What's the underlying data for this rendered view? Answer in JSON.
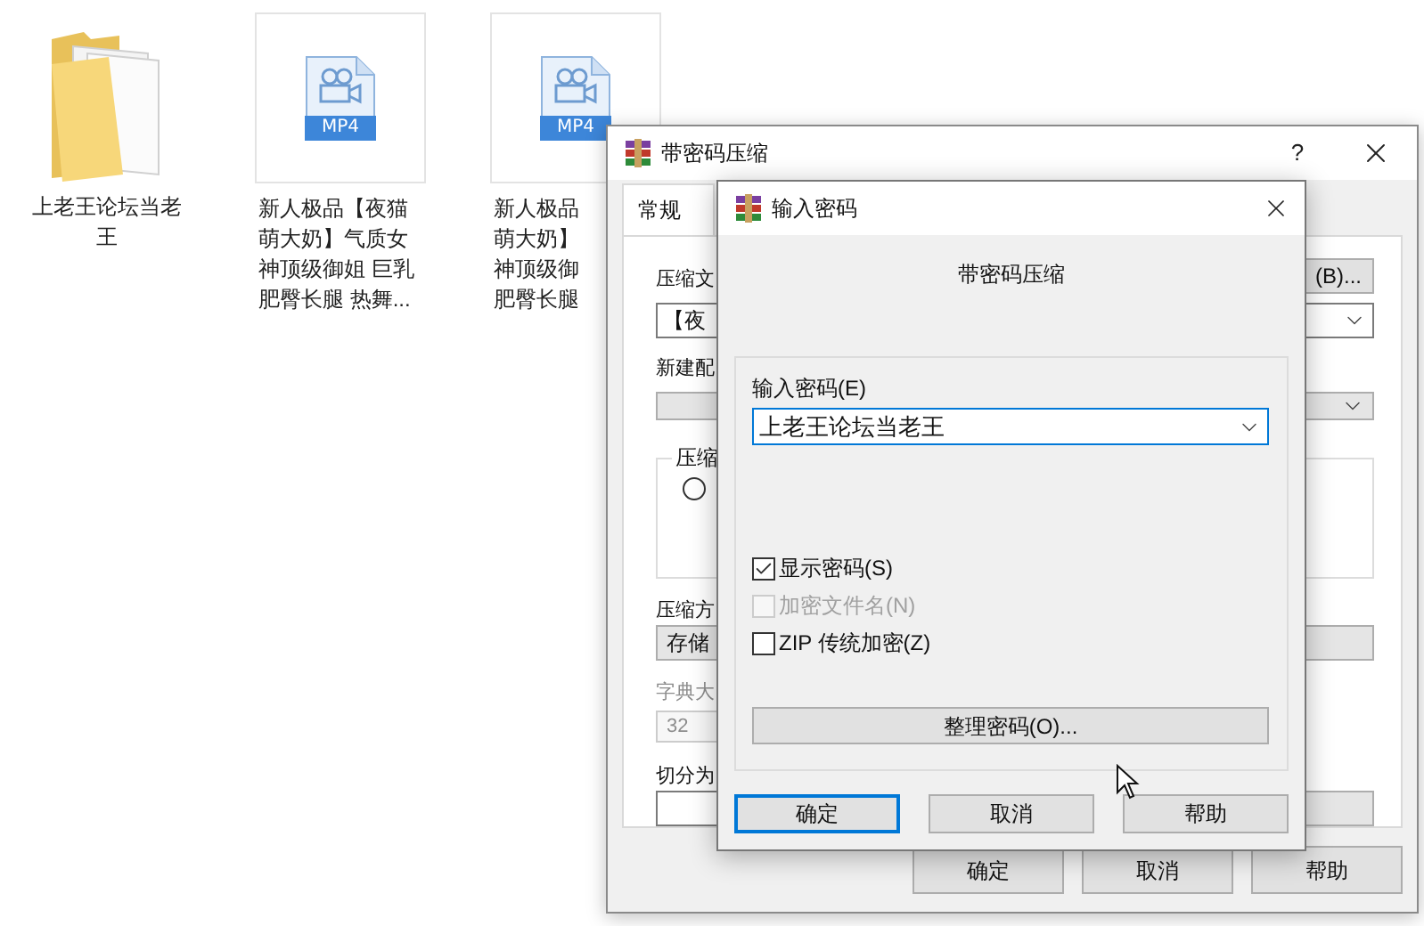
{
  "desktop_items": [
    {
      "kind": "folder",
      "label": "上老王论坛当老王"
    },
    {
      "kind": "video",
      "badge": "MP4",
      "label": "新人极品【夜猫萌大奶】气质女神顶级御姐 巨乳肥臀长腿 热舞..."
    },
    {
      "kind": "video",
      "badge": "MP4",
      "label_lines": [
        "新人极品",
        "萌大奶】",
        "神顶级御",
        "肥臀长腿"
      ]
    }
  ],
  "archive_dialog": {
    "title": "带密码压缩",
    "help": "?",
    "tabs": [
      {
        "label": "常规",
        "selected": true
      }
    ],
    "archive_name_label": "压缩文",
    "browse_button": "(B)...",
    "archive_name_value": "【夜",
    "profile_label": "新建配",
    "group_label": "压缩",
    "format_radio": {
      "selected": false
    },
    "method_label": "压缩方",
    "method_value": "存储",
    "dictionary_label": "字典大",
    "dictionary_value": "32",
    "split_label": "切分为",
    "buttons": [
      "确定",
      "取消",
      "帮助"
    ]
  },
  "password_dialog": {
    "title": "输入密码",
    "heading": "带密码压缩",
    "password_label": "输入密码(E)",
    "password_value": "上老王论坛当老王",
    "options": [
      {
        "label": "显示密码(S)",
        "checked": true,
        "disabled": false
      },
      {
        "label": "加密文件名(N)",
        "checked": false,
        "disabled": true
      },
      {
        "label": "ZIP 传统加密(Z)",
        "checked": false,
        "disabled": false
      }
    ],
    "manage_button": "整理密码(O)...",
    "buttons": [
      {
        "label": "确定",
        "default": true
      },
      {
        "label": "取消",
        "default": false
      },
      {
        "label": "帮助",
        "default": false
      }
    ]
  }
}
